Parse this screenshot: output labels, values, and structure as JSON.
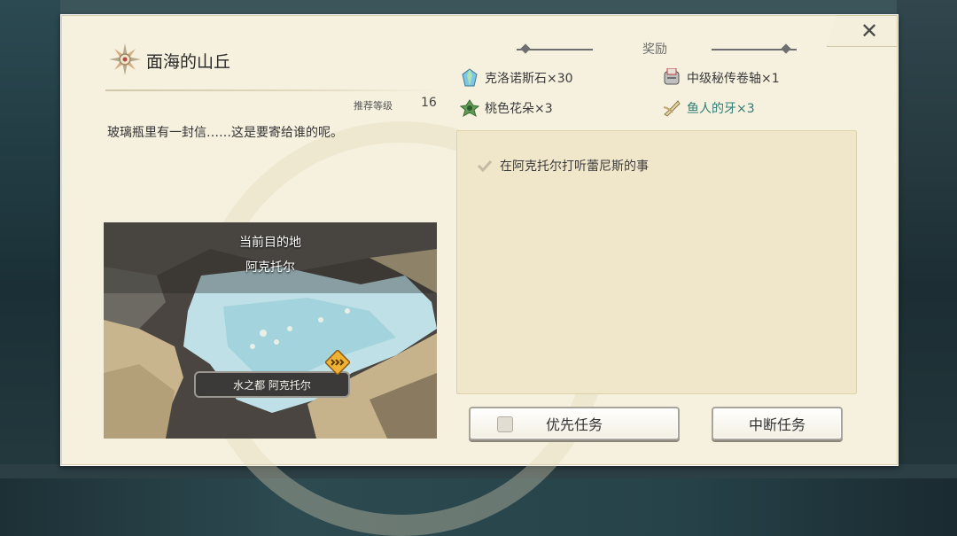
{
  "quest": {
    "title": "面海的山丘",
    "recommended_level_label": "推荐等级",
    "recommended_level_value": "16",
    "description": "玻璃瓶里有一封信……这是要寄给谁的呢。"
  },
  "map": {
    "destination_heading": "当前目的地",
    "destination_name": "阿克托尔",
    "location_label": "水之都 阿克托尔"
  },
  "rewards": {
    "title": "奖励",
    "items": [
      {
        "name": "克洛诺斯石×30",
        "icon": "crystal-icon"
      },
      {
        "name": "中级秘传卷轴×1",
        "icon": "scroll-icon"
      },
      {
        "name": "桃色花朵×3",
        "icon": "flower-icon"
      },
      {
        "name": "鱼人的牙×3",
        "icon": "fang-icon"
      }
    ]
  },
  "objectives": [
    {
      "text": "在阿克托尔打听蕾尼斯的事",
      "done": true
    }
  ],
  "buttons": {
    "priority": "优先任务",
    "abort": "中断任务",
    "close": "✕"
  },
  "colors": {
    "panel_bg": "#f6f1df",
    "objective_bg": "#f0e7cb",
    "highlight_reward": "#2f7b74"
  }
}
